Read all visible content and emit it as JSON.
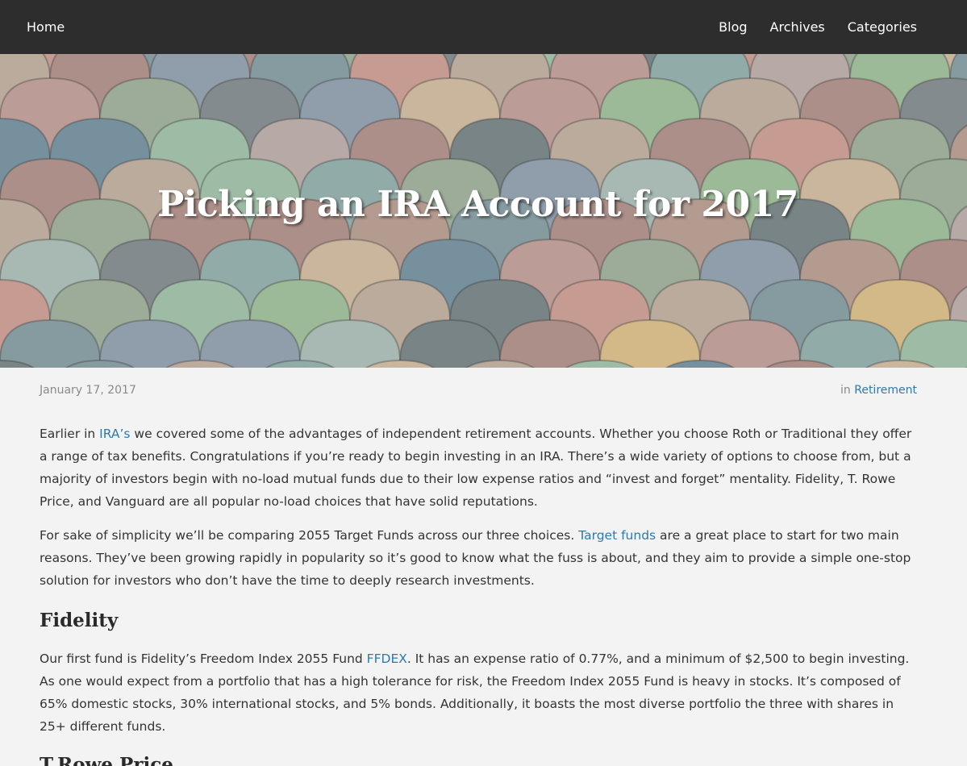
{
  "nav": {
    "home": "Home",
    "items": [
      "Blog",
      "Archives",
      "Categories"
    ]
  },
  "hero": {
    "title": "Picking an IRA Account for 2017"
  },
  "meta": {
    "date": "January 17, 2017",
    "in_label": "in",
    "category": "Retirement"
  },
  "article": {
    "p1": {
      "pre": "Earlier in ",
      "link": "IRA’s",
      "post": " we covered some of the advantages of independent retirement accounts. Whether you choose Roth or Traditional they offer a range of tax benefits. Congratulations if you’re ready to begin investing in an IRA. There’s a wide variety of options to choose from, but a majority of investors begin with no-load mutual funds due to their low expense ratios and “invest and forget” mentality. Fidelity, T. Rowe Price, and Vanguard are all popular no-load choices that have solid reputations."
    },
    "p2": {
      "pre": "For sake of simplicity we’ll be comparing 2055 Target Funds across our three choices. ",
      "link": "Target funds",
      "post": " are a great place to start for two main reasons. They’ve been growing rapidly in popularity so it’s good to know what the fuss is about, and they aim to provide a simple one-stop solution for investors who don’t have the time to deeply research investments."
    },
    "h_fidelity": "Fidelity",
    "p3": {
      "pre": "Our first fund is Fidelity’s Freedom Index 2055 Fund ",
      "link": "FFDEX",
      "post": ". It has an expense ratio of 0.77%, and a minimum of $2,500 to begin investing. As one would expect from a portfolio that has a high tolerance for risk, the Freedom Index 2055 Fund is heavy in stocks. It’s composed of 65% domestic stocks, 30% international stocks, and 5% bonds. Additionally, it boasts the most diverse portfolio the three with shares in 25+ different funds."
    },
    "h_trowe": "T.Rowe Price"
  },
  "colors": {
    "nav_bg": "#2d2d2d",
    "link": "#2a7ab0",
    "page_bg": "#f3f3f3"
  }
}
